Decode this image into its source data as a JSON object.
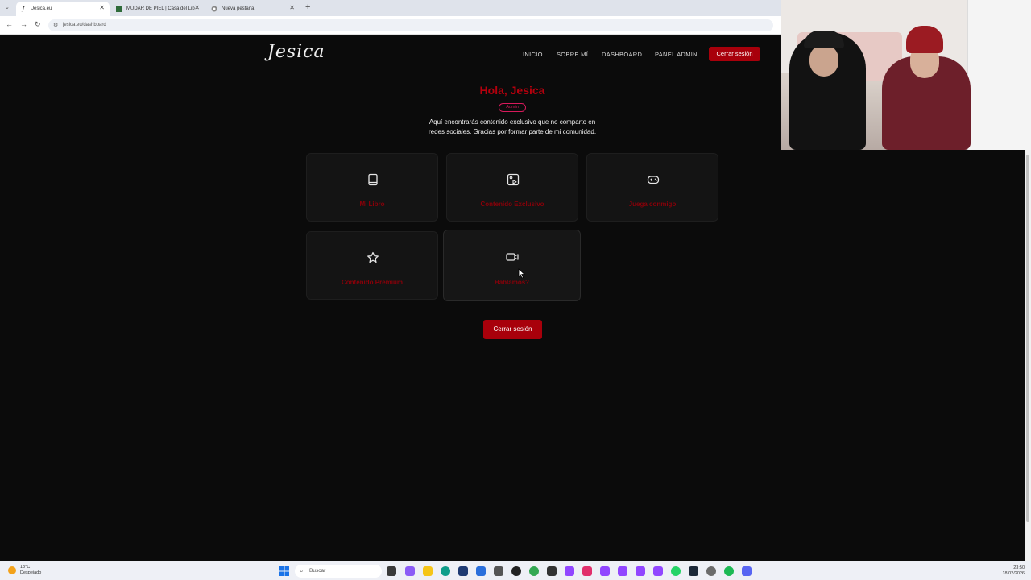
{
  "browser": {
    "tabs": [
      {
        "title": "Jesica.eu",
        "active": true
      },
      {
        "title": "MUDAR DE PIEL | Casa del Lib",
        "active": false
      },
      {
        "title": "Nueva pestaña",
        "active": false
      }
    ],
    "new_tab_symbol": "+",
    "url": "jesica.eu/dashboard"
  },
  "site": {
    "logo": "Jesica",
    "nav": [
      "INICIO",
      "SOBRE MÍ",
      "DASHBOARD",
      "PANEL ADMIN"
    ],
    "logout_label": "Cerrar sesión"
  },
  "dashboard": {
    "greeting": "Hola, Jesica",
    "role_badge": "Admin",
    "intro_line1": "Aquí encontrarás contenido exclusivo que no comparto en",
    "intro_line2": "redes sociales. Gracias por formar parte de mi comunidad.",
    "cards": [
      {
        "label": "Mi Libro",
        "icon": "book-icon"
      },
      {
        "label": "Contenido Exclusivo",
        "icon": "image-play-icon"
      },
      {
        "label": "Juega conmigo",
        "icon": "gamepad-icon"
      },
      {
        "label": "Contenido Premium",
        "icon": "star-icon"
      },
      {
        "label": "Hablamos?",
        "icon": "video-camera-icon"
      }
    ],
    "logout_label": "Cerrar sesión"
  },
  "taskbar": {
    "weather_temp": "13°C",
    "weather_desc": "Despejado",
    "search_placeholder": "Buscar",
    "time": "23:50",
    "date": "18/02/2026"
  },
  "colors": {
    "accent": "#a8000b",
    "card_label": "#8a0009",
    "badge": "#d81a5b",
    "background": "#0b0b0b"
  }
}
